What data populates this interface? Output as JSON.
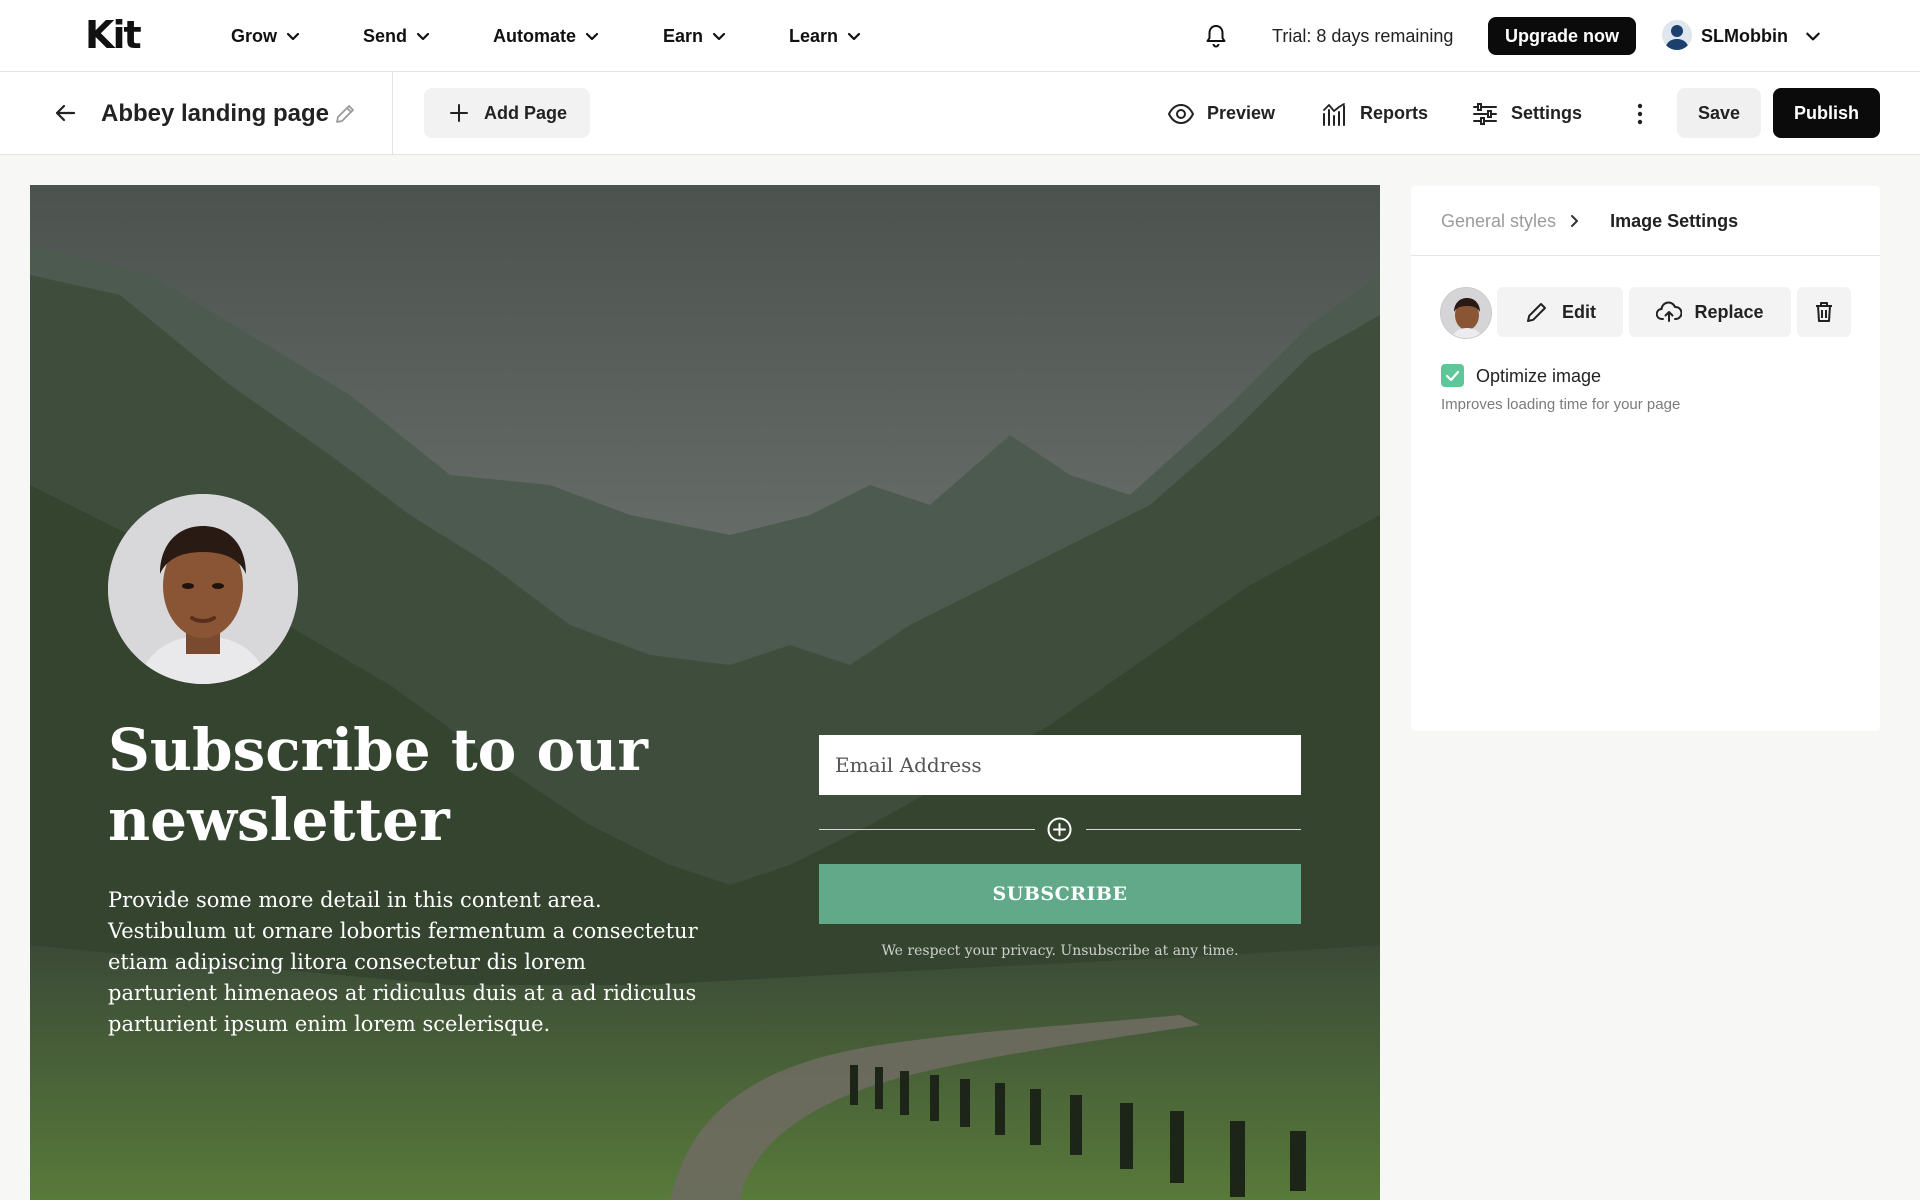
{
  "topnav": {
    "logo": "Kit",
    "menus": [
      {
        "label": "Grow"
      },
      {
        "label": "Send"
      },
      {
        "label": "Automate"
      },
      {
        "label": "Earn"
      },
      {
        "label": "Learn"
      }
    ],
    "trial_text": "Trial: 8 days remaining",
    "upgrade_label": "Upgrade now",
    "username": "SLMobbin"
  },
  "toolbar": {
    "page_title": "Abbey landing page",
    "add_page_label": "Add Page",
    "preview_label": "Preview",
    "reports_label": "Reports",
    "settings_label": "Settings",
    "save_label": "Save",
    "publish_label": "Publish"
  },
  "canvas": {
    "headline": "Subscribe to our newsletter",
    "body": "Provide some more detail in this content area. Vestibulum ut ornare lobortis fermentum a consectetur etiam adipiscing litora consectetur dis lorem parturient himenaeos at ridiculus duis at a ad ridiculus parturient ipsum enim lorem scelerisque.",
    "email_placeholder": "Email Address",
    "subscribe_label": "SUBSCRIBE",
    "privacy_text": "We respect your privacy. Unsubscribe at any time.",
    "button_color": "#62a98a"
  },
  "panel": {
    "breadcrumb_parent": "General styles",
    "breadcrumb_current": "Image Settings",
    "edit_label": "Edit",
    "replace_label": "Replace",
    "optimize_label": "Optimize image",
    "optimize_checked": true,
    "optimize_help": "Improves loading time for your page",
    "check_color": "#5ec79a"
  }
}
